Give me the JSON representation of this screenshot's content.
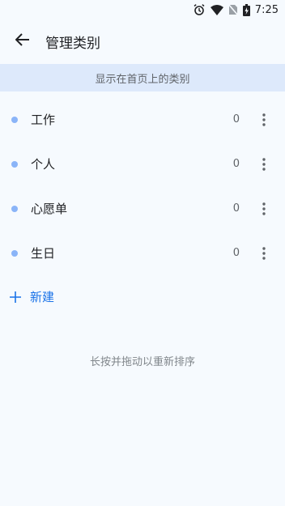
{
  "status_bar": {
    "time": "7:25",
    "icons": [
      "alarm-icon",
      "wifi-icon",
      "no-sim-icon",
      "battery-charging-icon"
    ]
  },
  "app_bar": {
    "back_icon": "arrow-back-icon",
    "title": "管理类别"
  },
  "section": {
    "header": "显示在首页上的类别"
  },
  "categories": [
    {
      "name": "工作",
      "count": "0"
    },
    {
      "name": "个人",
      "count": "0"
    },
    {
      "name": "心愿单",
      "count": "0"
    },
    {
      "name": "生日",
      "count": "0"
    }
  ],
  "new_button": {
    "label": "新建",
    "icon": "plus-icon"
  },
  "hint": "长按并拖动以重新排序",
  "colors": {
    "background": "#f6fafe",
    "section_header_bg": "#dde9fb",
    "dot": "#8ab4f8",
    "accent": "#1a73e8"
  }
}
